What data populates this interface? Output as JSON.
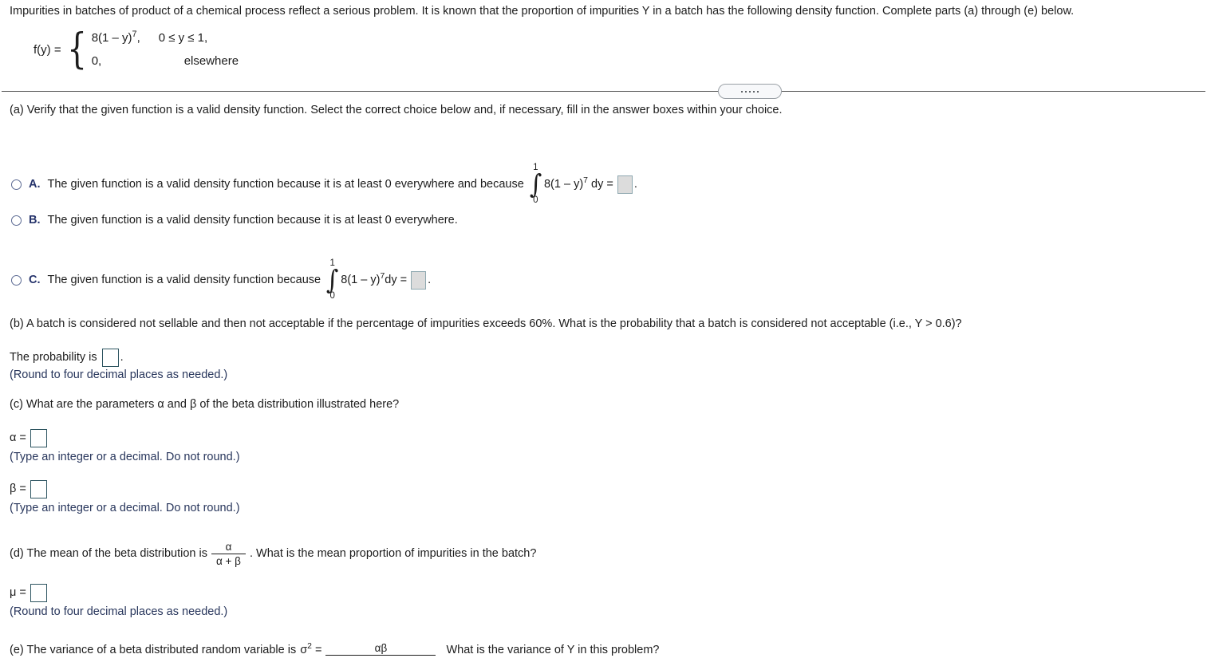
{
  "problem": {
    "stem": "Impurities in batches of product of a chemical process reflect a serious problem. It is known that the proportion of impurities Y in a batch has the following density function. Complete parts (a) through (e) below.",
    "density": {
      "function_label": "f(y) =",
      "case1_expr_pre": "8(1 – y)",
      "case1_expr_exp": "7",
      "case1_expr_post": ",",
      "case1_condition": "0 ≤ y ≤ 1,",
      "case2_expr": "0,",
      "case2_condition": "elsewhere"
    }
  },
  "divider": {
    "dots": 5
  },
  "part_a": {
    "prompt": "(a) Verify that the given function is a valid density function. Select the correct choice below and, if necessary, fill in the answer boxes within your choice.",
    "choices": [
      {
        "letter": "A.",
        "text": "The given function is a valid density function because it is at least 0 everywhere and because",
        "has_integral": true,
        "integral": {
          "upper": "1",
          "lower": "0",
          "symbol": "∫",
          "integrand_pre": "8(1 – y)",
          "integrand_exp": "7",
          "differential": "dy =",
          "spacing": "wide"
        },
        "box_style": "gray",
        "trailing": "."
      },
      {
        "letter": "B.",
        "text": "The given function is a valid density function because it is at least 0 everywhere.",
        "has_integral": false
      },
      {
        "letter": "C.",
        "text": "The given function is a valid density function because",
        "has_integral": true,
        "integral": {
          "upper": "1",
          "lower": "0",
          "symbol": "∫",
          "integrand_pre": "8(1 – y)",
          "integrand_exp": "7",
          "differential": "dy =",
          "spacing": "tight"
        },
        "box_style": "gray",
        "trailing": "."
      }
    ]
  },
  "part_b": {
    "prompt": "(b) A batch is considered not sellable and then not acceptable if the percentage of impurities exceeds 60%. What is the probability that a batch is considered not acceptable (i.e., Y > 0.6)?",
    "answer_label": "The probability is",
    "answer_trailing": ".",
    "instruction": "(Round to four decimal places as needed.)"
  },
  "part_c": {
    "prompt": "(c) What are the parameters α and β of the beta distribution illustrated here?",
    "alpha_label": "α =",
    "alpha_instruction": "(Type an integer or a decimal. Do not round.)",
    "beta_label": "β =",
    "beta_instruction": "(Type an integer or a decimal. Do not round.)"
  },
  "part_d": {
    "prompt_pre": "(d) The mean of the beta distribution is",
    "fraction_num": "α",
    "fraction_den": "α + β",
    "prompt_post": ". What is the mean proportion of impurities in the batch?",
    "mu_label": "μ =",
    "instruction": "(Round to four decimal places as needed.)"
  },
  "part_e": {
    "prompt_pre": "(e) The variance of a beta distributed random variable is",
    "sigma": "σ",
    "sigma_exp": "2",
    "equals": "=",
    "fraction_num": "αβ",
    "fraction_den": "",
    "prompt_post": "What is the variance of Y in this problem?"
  }
}
